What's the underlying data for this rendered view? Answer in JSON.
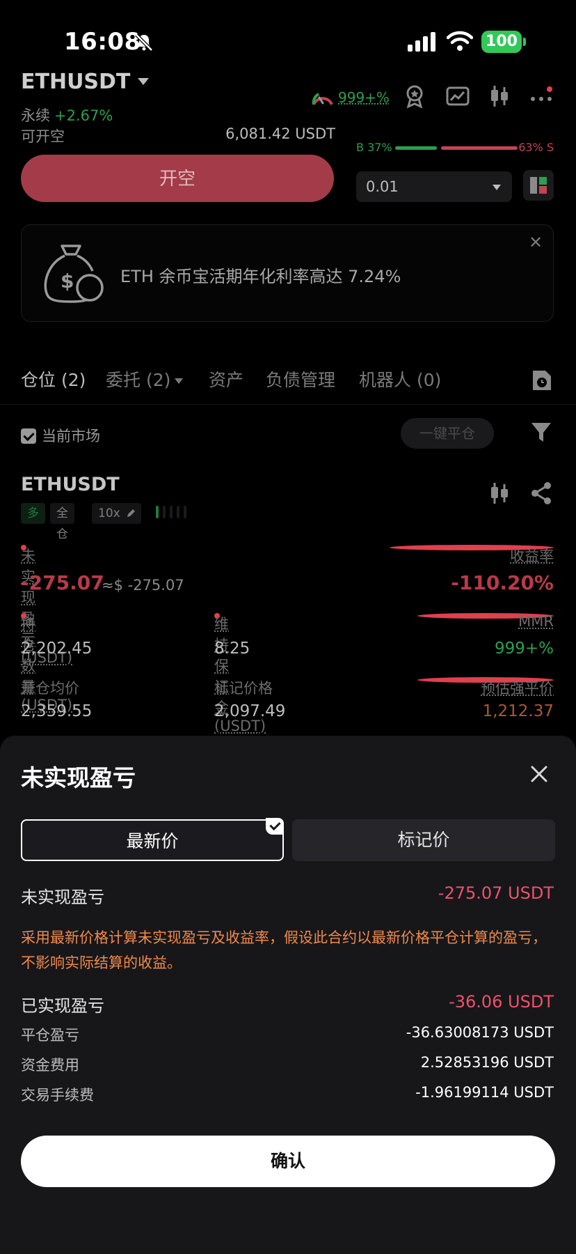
{
  "status": {
    "time": "16:08",
    "battery": "100"
  },
  "header": {
    "pair": "ETHUSDT",
    "contract_type": "永续",
    "change": "+2.67%",
    "can_open_label": "可开空",
    "available": "6,081.42 USDT",
    "risk_value": "999+%",
    "ratio_buy": "B 37%",
    "ratio_sell": "63% S",
    "buy_ratio_pct": 37,
    "open_short_label": "开空",
    "quantity": "0.01"
  },
  "promo": {
    "text": "ETH 余币宝活期年化利率高达 7.24%"
  },
  "tabs": [
    {
      "label": "仓位 (2)"
    },
    {
      "label": "委托 (2)"
    },
    {
      "label": "资产"
    },
    {
      "label": "负债管理"
    },
    {
      "label": "机器人 (0)"
    }
  ],
  "filter_bar": {
    "current_market": "当前市场",
    "close_all": "一键平仓"
  },
  "position": {
    "symbol": "ETHUSDT",
    "tags": {
      "side": "多",
      "margin_mode": "全仓",
      "leverage": "10x"
    },
    "unrealized_label": "未实现盈亏 (USDT)",
    "unrealized_value": "-275.07",
    "unrealized_approx": "≈$ -275.07",
    "roi_label": "收益率",
    "roi_value": "-110.20%",
    "size_label": "持仓数量 (USDT)",
    "size_value": "2,202.45",
    "maint_margin_label": "维持保证金 (USDT)",
    "maint_margin_value": "8.25",
    "mmr_label": "MMR",
    "mmr_value": "999+%",
    "entry_label": "开仓均价",
    "entry_value": "2,359.55",
    "mark_label": "标记价格",
    "mark_value": "2,097.49",
    "liq_label": "预估强平价",
    "liq_value": "1,212.37"
  },
  "sheet": {
    "title": "未实现盈亏",
    "seg_latest": "最新价",
    "seg_mark": "标记价",
    "unrealized_label": "未实现盈亏",
    "unrealized_value": "-275.07 USDT",
    "note": "采用最新价格计算未实现盈亏及收益率，假设此合约以最新价格平仓计算的盈亏，不影响实际结算的收益。",
    "realized_label": "已实现盈亏",
    "realized_value": "-36.06 USDT",
    "close_pnl_label": "平仓盈亏",
    "close_pnl_value": "-36.63008173 USDT",
    "funding_label": "资金费用",
    "funding_value": "2.52853196 USDT",
    "fee_label": "交易手续费",
    "fee_value": "-1.96199114 USDT",
    "confirm": "确认"
  },
  "colors": {
    "short_button": "#a33c48",
    "positive": "#2e9e4e",
    "negative": "#f0506b",
    "note": "#f0894a"
  }
}
